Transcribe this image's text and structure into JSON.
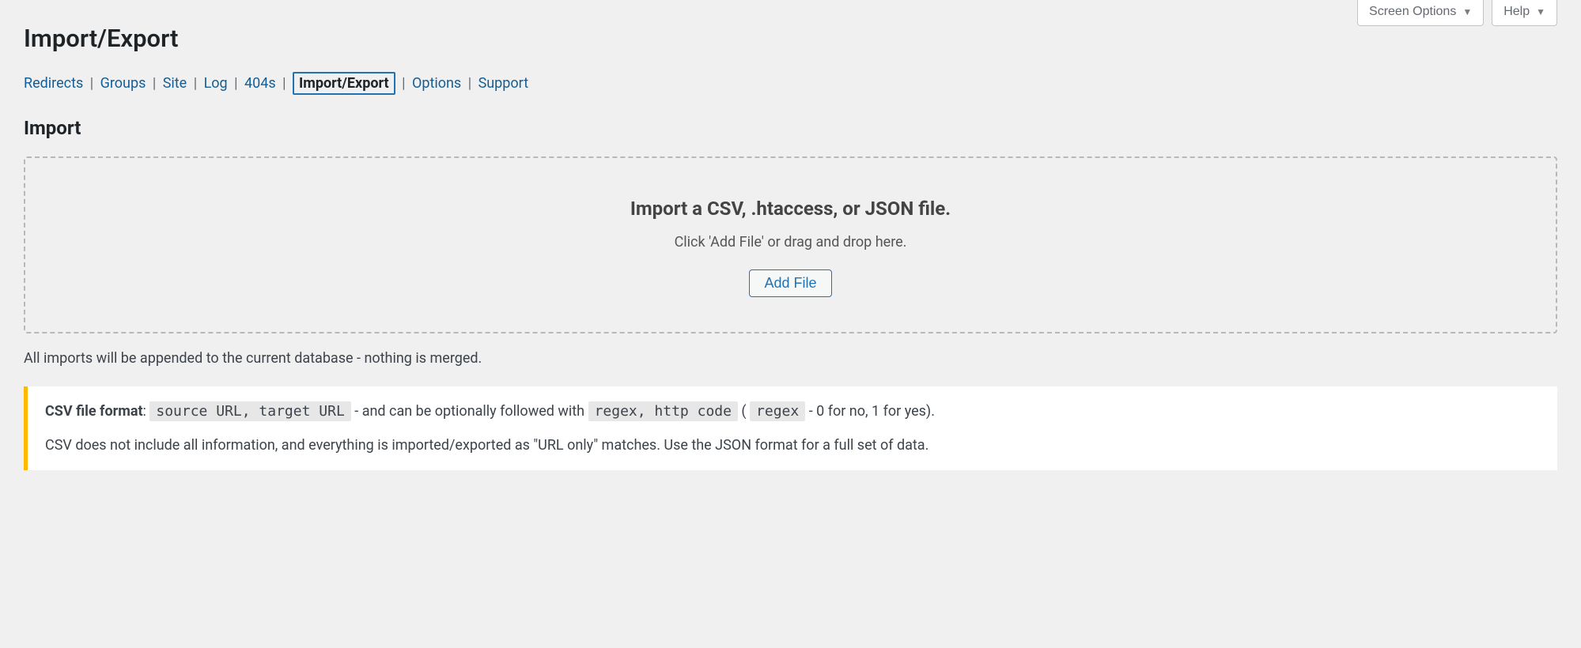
{
  "topControls": {
    "screenOptions": "Screen Options",
    "help": "Help"
  },
  "pageTitle": "Import/Export",
  "tabs": {
    "redirects": "Redirects",
    "groups": "Groups",
    "site": "Site",
    "log": "Log",
    "s404": "404s",
    "importExport": "Import/Export",
    "options": "Options",
    "support": "Support"
  },
  "sectionTitle": "Import",
  "dropzone": {
    "heading": "Import a CSV, .htaccess, or JSON file.",
    "instruction": "Click 'Add File' or drag and drop here.",
    "button": "Add File"
  },
  "appendNote": "All imports will be appended to the current database - nothing is merged.",
  "csvInfo": {
    "labelStrong": "CSV file format",
    "colon": ": ",
    "code1": "source URL, target URL",
    "mid1": " - and can be optionally followed with ",
    "code2": "regex, http code",
    "mid2": " ( ",
    "code3": "regex",
    "tail": " - 0 for no, 1 for yes).",
    "line2": "CSV does not include all information, and everything is imported/exported as \"URL only\" matches. Use the JSON format for a full set of data."
  }
}
